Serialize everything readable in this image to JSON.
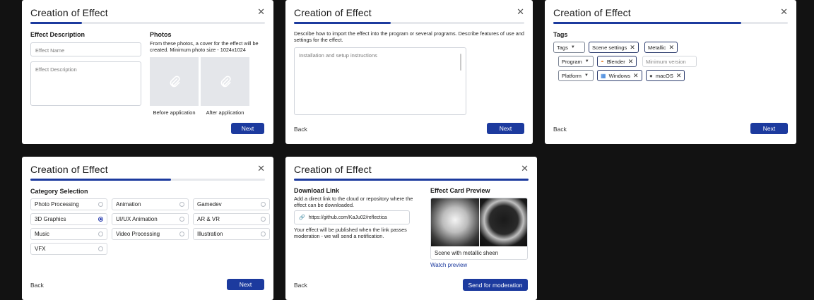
{
  "dialog_title": "Creation of Effect",
  "step1": {
    "section_left": "Effect Description",
    "name_placeholder": "Effect Name",
    "desc_placeholder": "Effect Description",
    "section_right": "Photos",
    "photos_hint": "From these photos, a cover for the effect will be created. Minimum photo size - 1024x1024",
    "before_label": "Before application",
    "after_label": "After application",
    "next_label": "Next",
    "progress": 0.22
  },
  "step2": {
    "hint": "Describe how to import the effect into the program or several programs. Describe features of use and settings for the effect.",
    "textarea_placeholder": "Installation and setup instructions",
    "back_label": "Back",
    "next_label": "Next",
    "progress": 0.42
  },
  "step3": {
    "section": "Tags",
    "rows": [
      {
        "type": "Tags",
        "chips": [
          "Scene settings",
          "Metallic"
        ]
      },
      {
        "type": "Program",
        "chips": [
          "Blender"
        ],
        "placeholder": "Minimum version"
      },
      {
        "type": "Platform",
        "chips": [
          "Windows",
          "macOS"
        ]
      }
    ],
    "back_label": "Back",
    "next_label": "Next",
    "progress": 0.8
  },
  "step4": {
    "section": "Category Selection",
    "options": [
      {
        "label": "Photo Processing",
        "selected": false
      },
      {
        "label": "Animation",
        "selected": false
      },
      {
        "label": "Gamedev",
        "selected": false
      },
      {
        "label": "3D Graphics",
        "selected": true
      },
      {
        "label": "UI/UX Animation",
        "selected": false
      },
      {
        "label": "AR & VR",
        "selected": false
      },
      {
        "label": "Music",
        "selected": false
      },
      {
        "label": "Video Processing",
        "selected": false
      },
      {
        "label": "Illustration",
        "selected": false
      },
      {
        "label": "VFX",
        "selected": false
      }
    ],
    "back_label": "Back",
    "next_label": "Next",
    "progress": 0.6
  },
  "step5": {
    "section_left": "Download Link",
    "link_hint": "Add a direct link to the cloud or repository where the effect can be downloaded.",
    "link_value": "https://github.com/KaJu02/reflectica",
    "publish_note": "Your effect will be published when the link passes moderation - we will send a notification.",
    "section_right": "Effect Card Preview",
    "preview_caption": "Scene with metallic sheen",
    "watch_preview": "Watch preview",
    "back_label": "Back",
    "submit_label": "Send for moderation",
    "progress": 1.0
  },
  "colors": {
    "accent": "#1c3a9e",
    "background": "#121212"
  }
}
